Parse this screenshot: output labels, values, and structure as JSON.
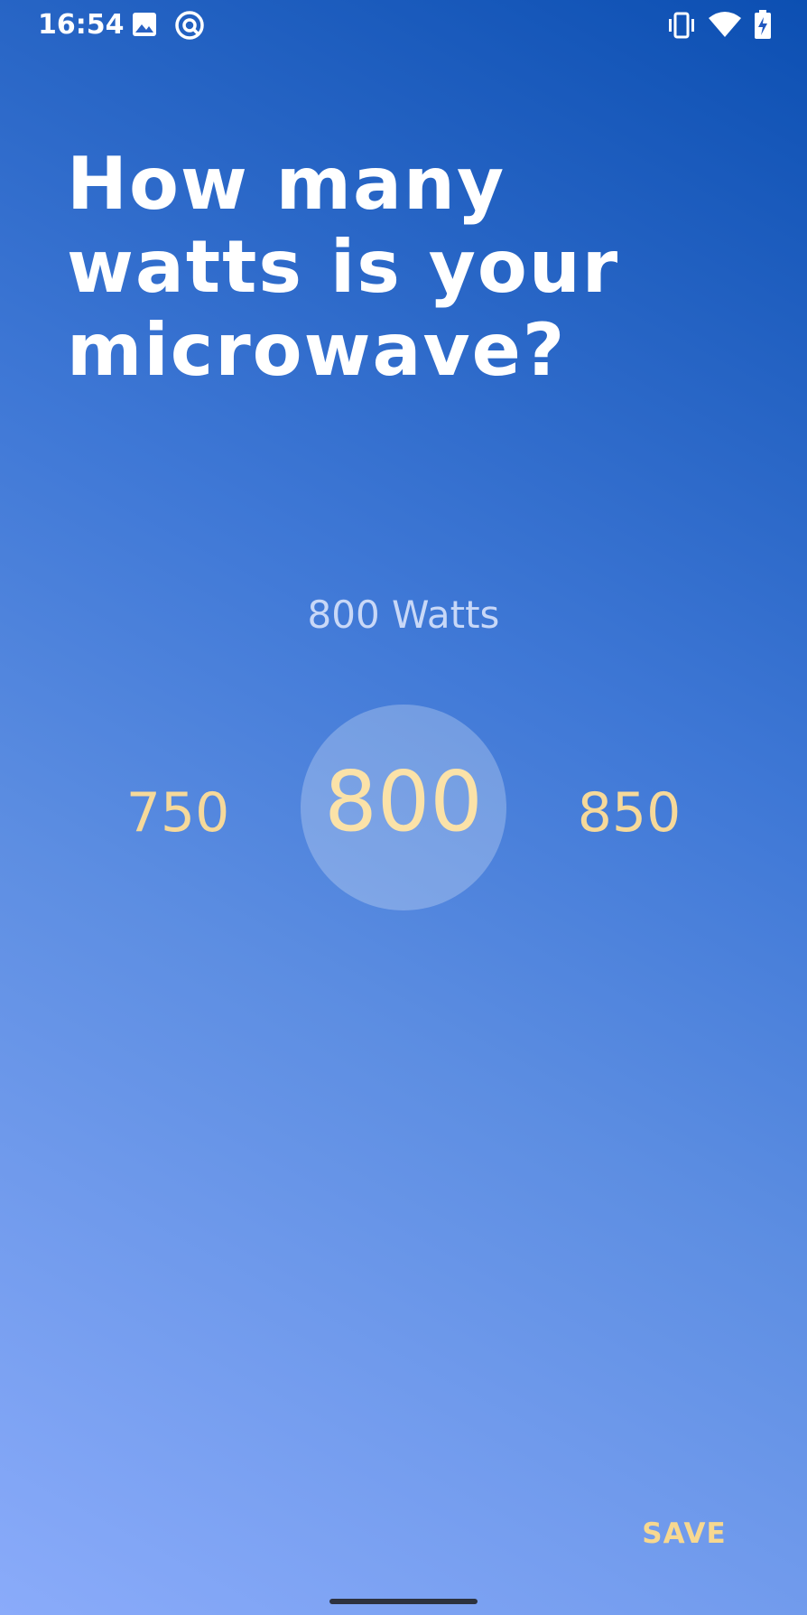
{
  "status_bar": {
    "time": "16:54",
    "icons_left": [
      "image-icon",
      "assistant-icon"
    ],
    "icons_right": [
      "vibrate-icon",
      "wifi-icon",
      "battery-charging-icon"
    ]
  },
  "screen": {
    "title": "How many watts is your microwave?",
    "unit_label": "800 Watts"
  },
  "picker": {
    "previous": "750",
    "selected": "800",
    "next": "850"
  },
  "actions": {
    "save_label": "SAVE"
  },
  "colors": {
    "background_top": "#0c4fb2",
    "background_bottom": "#8aabfa",
    "accent": "#f6d99a",
    "text": "#ffffff"
  }
}
